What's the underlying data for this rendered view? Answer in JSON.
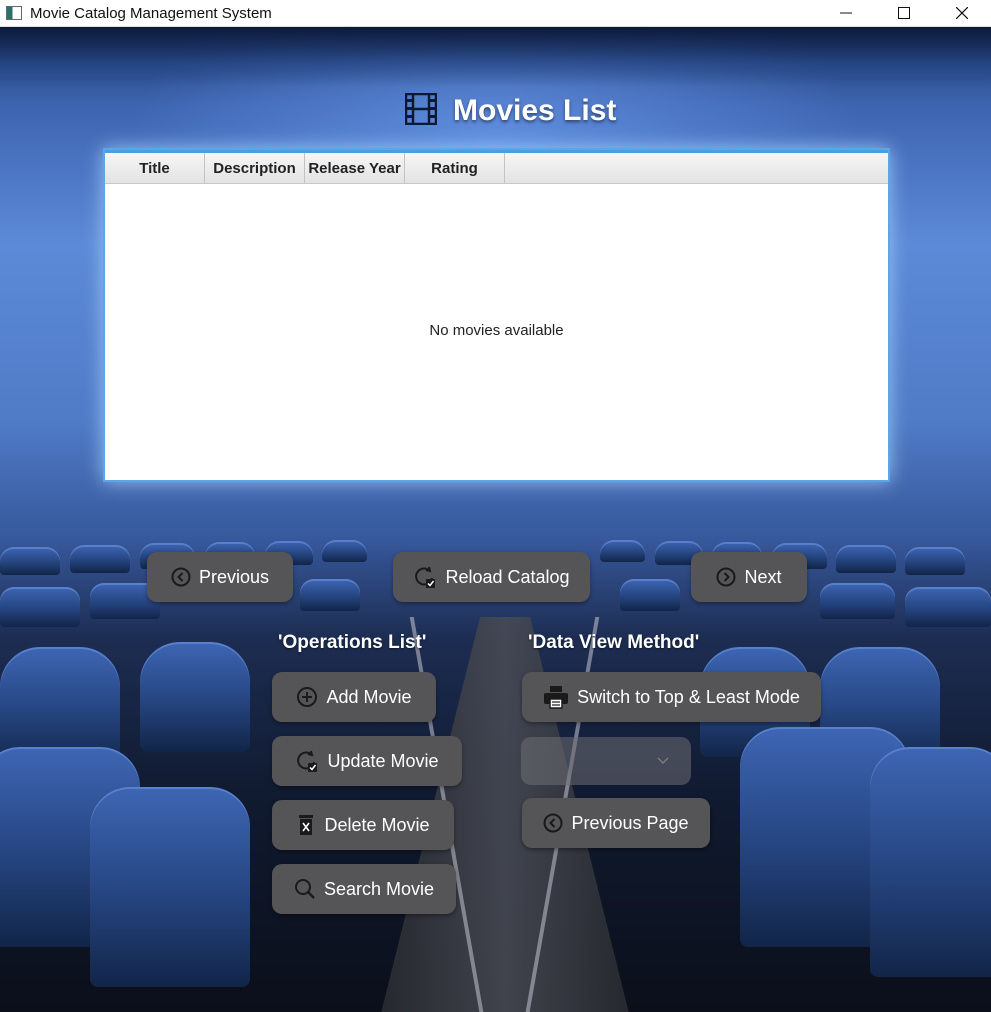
{
  "window": {
    "title": "Movie Catalog Management System"
  },
  "header": {
    "title": "Movies List"
  },
  "table": {
    "columns": [
      "Title",
      "Description",
      "Release Year",
      "Rating"
    ],
    "rows": [],
    "placeholder": "No movies available"
  },
  "navigation": {
    "previous_label": "Previous",
    "reload_label": "Reload Catalog",
    "next_label": "Next"
  },
  "operations": {
    "heading": "'Operations List'",
    "add_label": "Add Movie",
    "update_label": "Update Movie",
    "delete_label": "Delete Movie",
    "search_label": "Search Movie"
  },
  "data_view": {
    "heading": "'Data View Method'",
    "switch_label": "Switch to Top & Least Mode",
    "combo_value": "",
    "previous_page_label": "Previous Page"
  },
  "colors": {
    "button_bg": "#555558",
    "table_border": "#5aa6e6"
  }
}
